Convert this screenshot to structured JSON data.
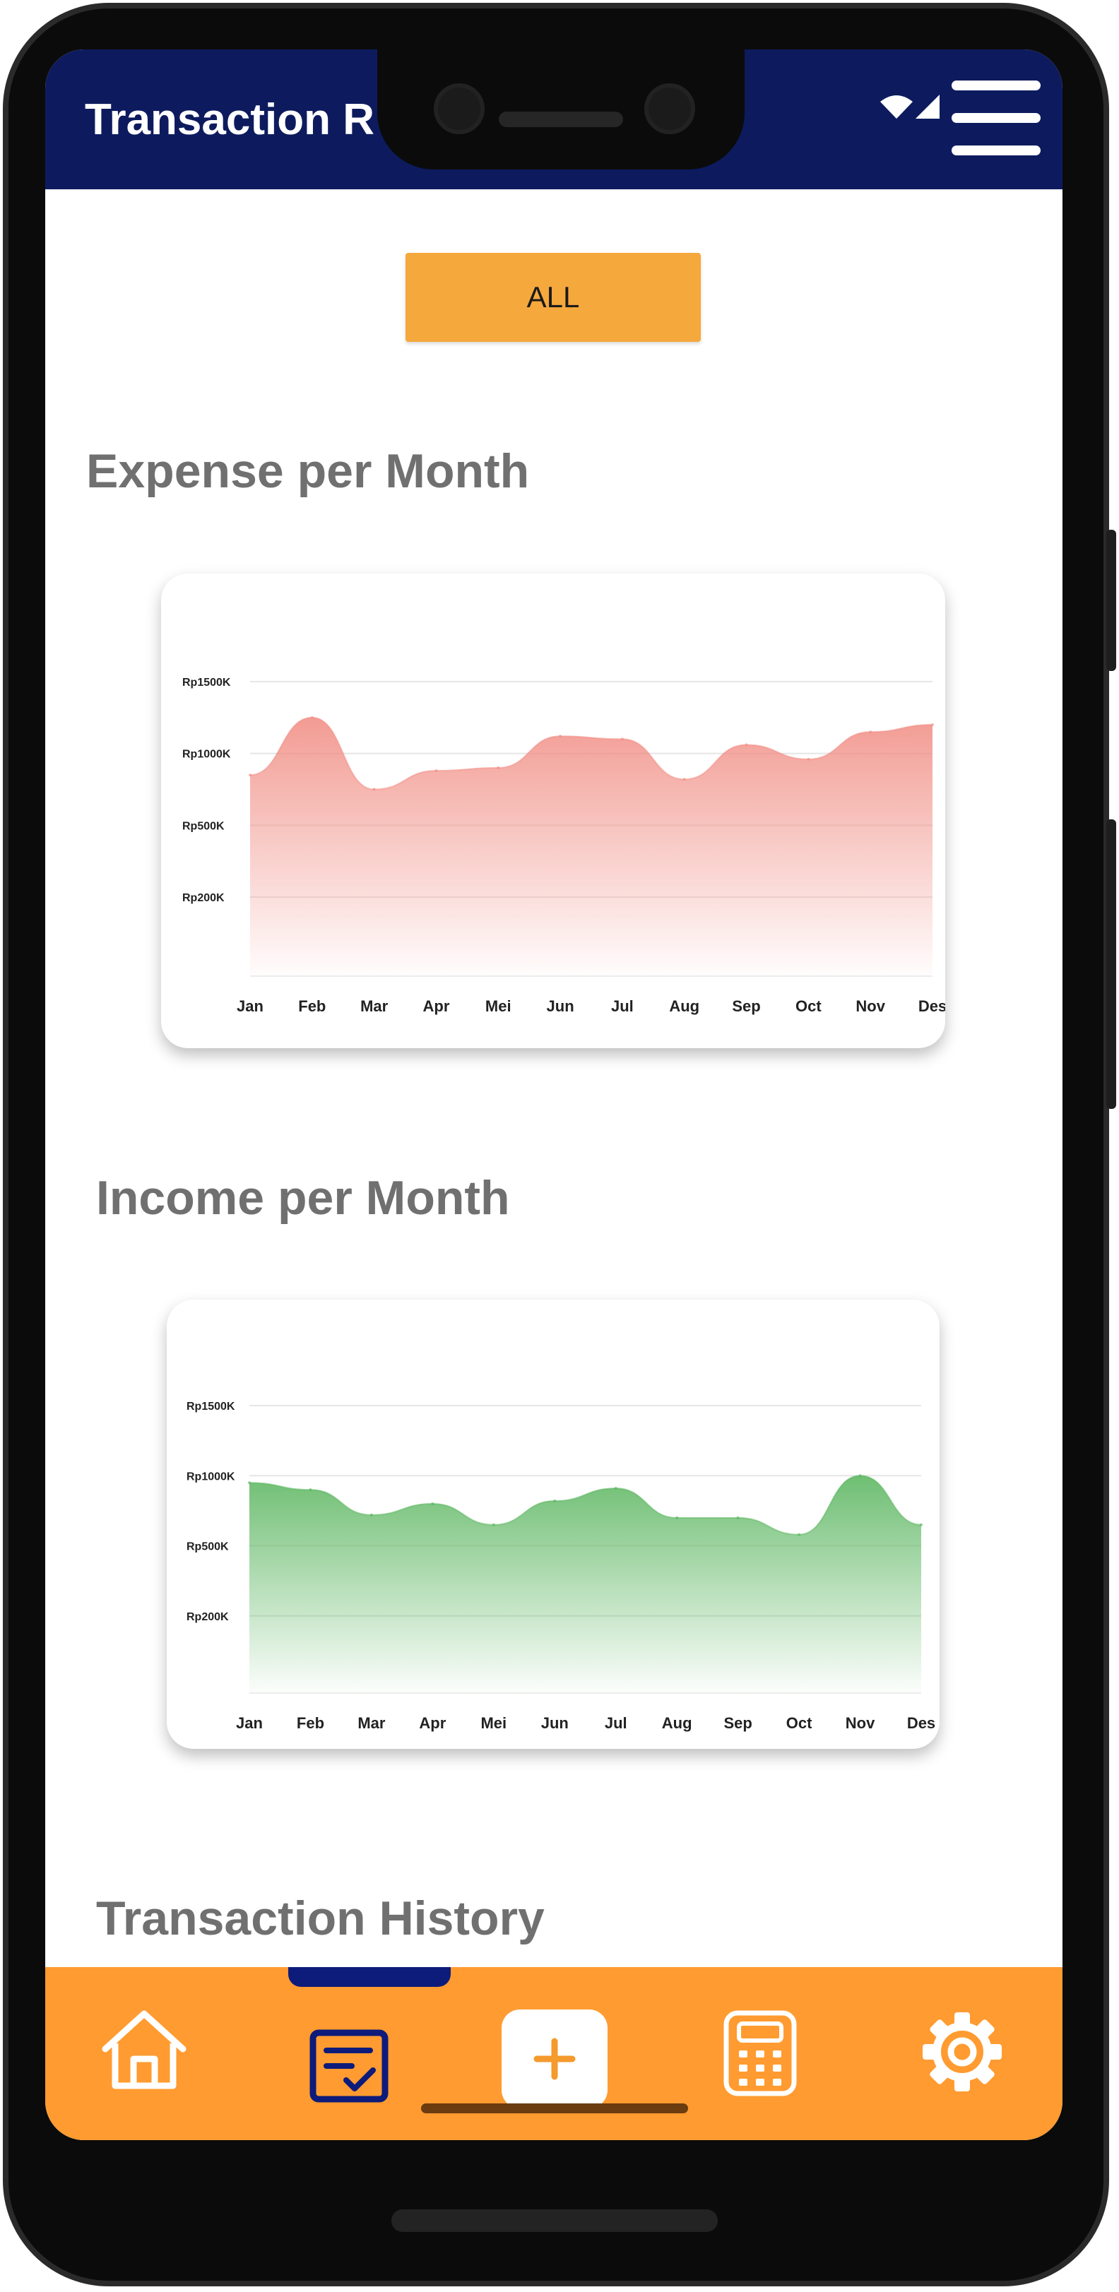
{
  "app": {
    "title": "Transaction R"
  },
  "filter": {
    "all_label": "ALL"
  },
  "expense_chart": {
    "section_title": "Expense per Month",
    "color": "#f08a80"
  },
  "income_chart": {
    "section_title": "Income per Month",
    "color": "#55b35a"
  },
  "history": {
    "section_title": "Transaction History"
  },
  "nav": {
    "items": [
      "home-icon",
      "checklist-icon",
      "add-icon",
      "calculator-icon",
      "gear-icon"
    ],
    "active": "checklist-icon",
    "accent": "#ff9b30"
  },
  "chart_data": [
    {
      "type": "area",
      "title": "Expense per Month",
      "categories": [
        "Jan",
        "Feb",
        "Mar",
        "Apr",
        "Mei",
        "Jun",
        "Jul",
        "Aug",
        "Sep",
        "Oct",
        "Nov",
        "Des"
      ],
      "series": [
        {
          "values": [
            850,
            1250,
            750,
            880,
            900,
            1120,
            1100,
            820,
            1060,
            960,
            1150,
            1200
          ]
        }
      ],
      "y_tick_labels": [
        "Rp1500K",
        "Rp1000K",
        "Rp500K",
        "Rp200K"
      ],
      "y_ticks": [
        1500,
        1000,
        500,
        0
      ],
      "ylim": [
        -550,
        1500
      ],
      "grid": true,
      "legend": false
    },
    {
      "type": "area",
      "title": "Income per Month",
      "categories": [
        "Jan",
        "Feb",
        "Mar",
        "Apr",
        "Mei",
        "Jun",
        "Jul",
        "Aug",
        "Sep",
        "Oct",
        "Nov",
        "Des"
      ],
      "series": [
        {
          "values": [
            950,
            900,
            720,
            800,
            650,
            820,
            910,
            700,
            700,
            580,
            1000,
            650
          ]
        }
      ],
      "y_tick_labels": [
        "Rp1500K",
        "Rp1000K",
        "Rp500K",
        "Rp200K"
      ],
      "y_ticks": [
        1500,
        1000,
        500,
        0
      ],
      "ylim": [
        -550,
        1500
      ],
      "grid": true,
      "legend": false
    }
  ]
}
